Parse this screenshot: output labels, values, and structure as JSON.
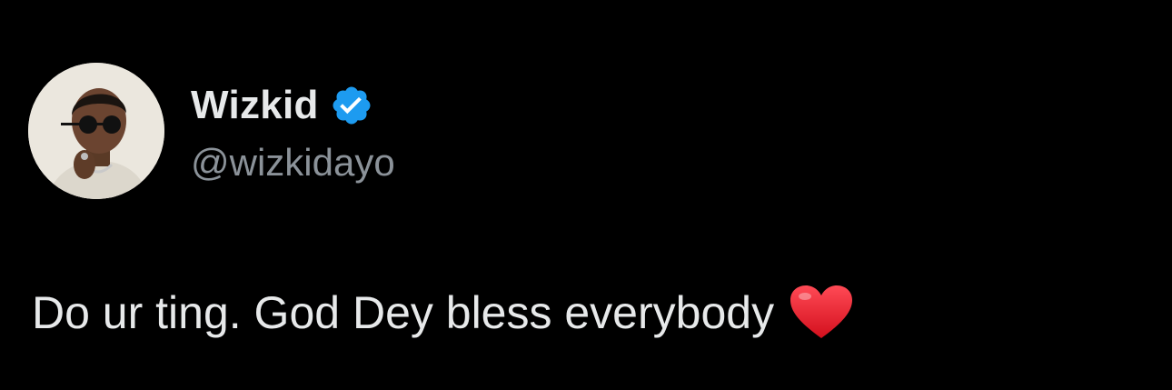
{
  "tweet": {
    "author": {
      "display_name": "Wizkid",
      "handle": "@wizkidayo",
      "verified": true,
      "verified_icon": "verified-badge-icon",
      "avatar": "profile-avatar"
    },
    "text": "Do ur ting. God Dey bless everybody",
    "emoji": "heart-icon"
  },
  "colors": {
    "background": "#000000",
    "text_primary": "#e7e9ea",
    "text_secondary": "#8b9299",
    "verified_blue": "#1d9bf0",
    "heart_red": "#e8202f"
  }
}
